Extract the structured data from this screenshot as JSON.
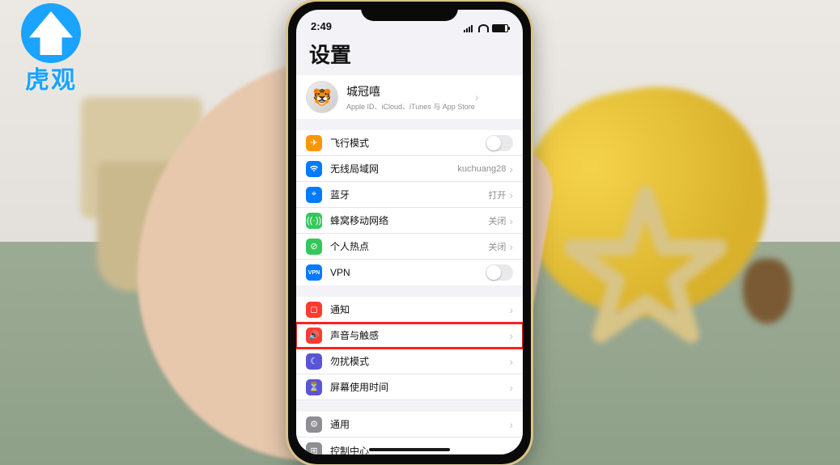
{
  "logo_text": "虎观",
  "statusbar": {
    "time": "2:49"
  },
  "page_title": "设置",
  "profile": {
    "name": "城冠嘻",
    "subtitle": "Apple ID、iCloud、iTunes 与 App Store"
  },
  "group1": {
    "airplane": {
      "label": "飞行模式"
    },
    "wifi": {
      "label": "无线局域网",
      "value": "kuchuang28"
    },
    "bluetooth": {
      "label": "蓝牙",
      "value": "打开"
    },
    "cellular": {
      "label": "蜂窝移动网络",
      "value": "关闭"
    },
    "hotspot": {
      "label": "个人热点",
      "value": "关闭"
    },
    "vpn": {
      "label": "VPN"
    }
  },
  "group2": {
    "notifications": {
      "label": "通知"
    },
    "sounds": {
      "label": "声音与触感"
    },
    "dnd": {
      "label": "勿扰模式"
    },
    "screentime": {
      "label": "屏幕使用时间"
    }
  },
  "group3": {
    "general": {
      "label": "通用"
    },
    "control": {
      "label": "控制中心"
    }
  }
}
